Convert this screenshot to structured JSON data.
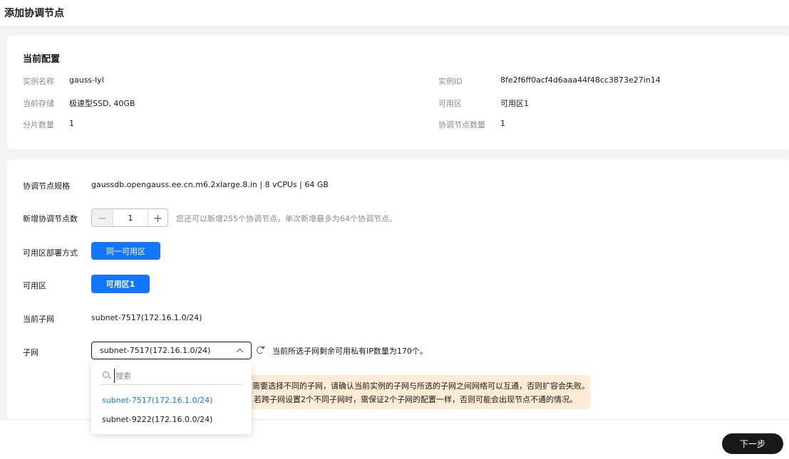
{
  "page": {
    "title": "添加协调节点"
  },
  "config": {
    "title": "当前配置",
    "rows": [
      {
        "label": "实例名称",
        "value": "gauss-lyl"
      },
      {
        "label": "实例ID",
        "value": "8fe2f6ff0acf4d6aaa44f48cc3873e27in14"
      },
      {
        "label": "当前存储",
        "value": "极速型SSD, 40GB"
      },
      {
        "label": "可用区",
        "value": "可用区1"
      },
      {
        "label": "分片数量",
        "value": "1"
      },
      {
        "label": "协调节点数量",
        "value": "1"
      }
    ]
  },
  "form": {
    "spec_label": "协调节点规格",
    "spec_value": "gaussdb.opengauss.ee.cn.m6.2xlarge.8.in | 8 vCPUs | 64 GB",
    "count_label": "新增协调节点数",
    "count_minus": "−",
    "count_value": "1",
    "count_plus": "+",
    "count_hint": "您还可以新增255个协调节点，单次新增最多为64个协调节点。",
    "deploy_label": "可用区部署方式",
    "deploy_option": "同一可用区",
    "az_label": "可用区",
    "az_option": "可用区1",
    "current_subnet_label": "当前子网",
    "current_subnet_value": "subnet-7517(172.16.1.0/24)",
    "subnet_label": "子网",
    "subnet_selected": "subnet-7517(172.16.1.0/24)",
    "subnet_hint": "当前所选子网剩余可用私有IP数量为170个。",
    "warn_line1": "需要选择不同的子网，请确认当前实例的子网与所选的子网之间网络可以互通，否则扩容会失败。",
    "warn_line2": "若跨子网设置2个不同子网时，需保证2个子网的配置一样，否则可能会出现节点不通的情况。"
  },
  "dropdown": {
    "search_placeholder": "搜索",
    "options": [
      {
        "label": "subnet-7517(172.16.1.0/24)",
        "selected": true
      },
      {
        "label": "subnet-9222(172.16.0.0/24)",
        "selected": false
      }
    ]
  },
  "footer": {
    "next_label": "下一步"
  },
  "colors": {
    "accent": "#1476ff",
    "warn_bg": "#fdebd5",
    "primary_dark": "#191919"
  }
}
